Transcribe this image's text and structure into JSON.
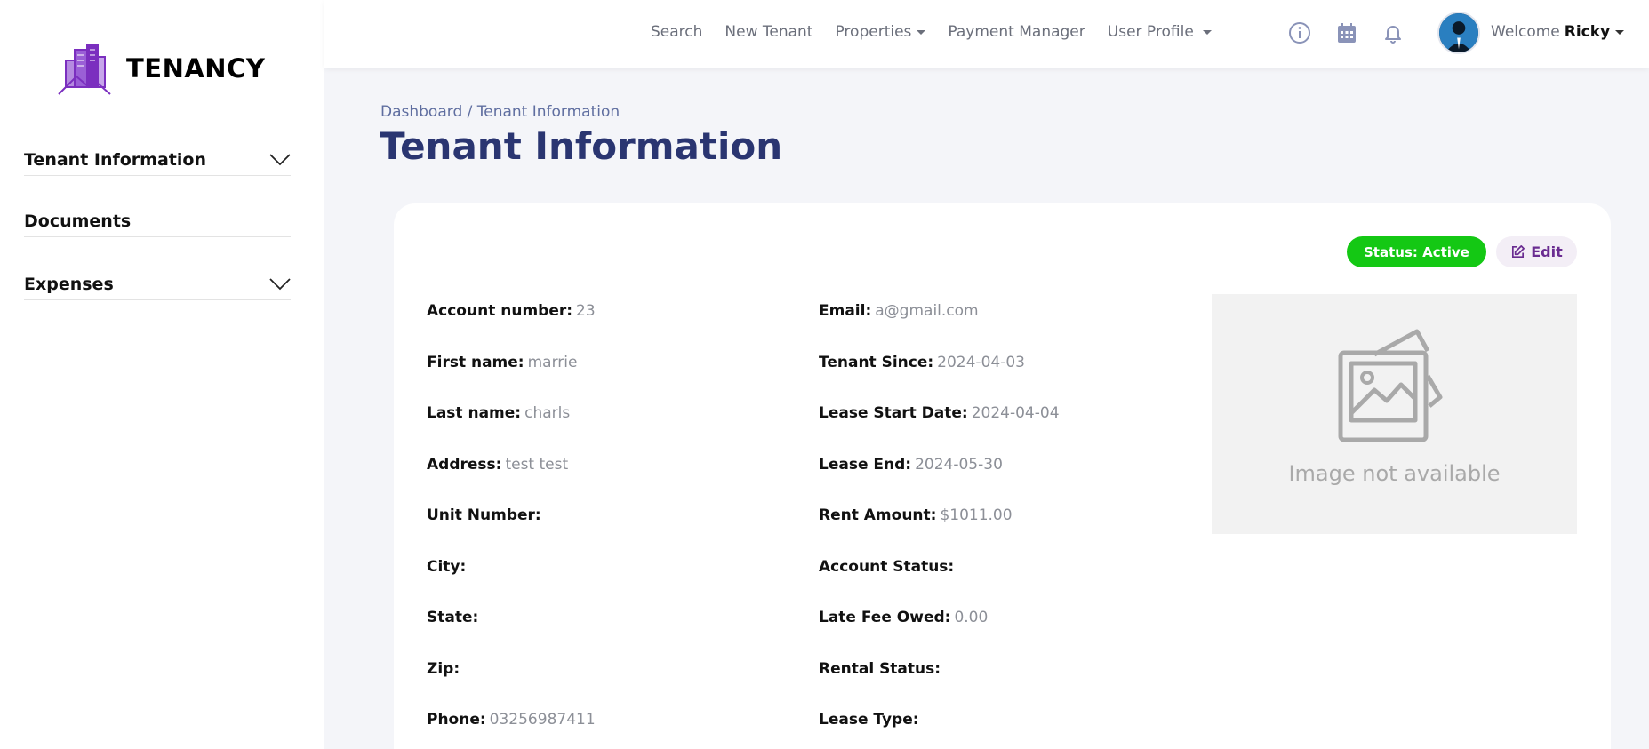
{
  "brand": {
    "name": "TENANCY"
  },
  "sidebar": {
    "items": [
      {
        "label": "Tenant Information",
        "has_chevron": true
      },
      {
        "label": "Documents",
        "has_chevron": false
      },
      {
        "label": "Expenses",
        "has_chevron": true
      }
    ]
  },
  "topnav": {
    "items": [
      {
        "label": "Search"
      },
      {
        "label": "New Tenant"
      },
      {
        "label": "Properties"
      },
      {
        "label": "Payment Manager"
      },
      {
        "label": "User Profile"
      }
    ],
    "icons": [
      "info-icon",
      "calendar-icon",
      "bell-icon"
    ],
    "welcome_prefix": "Welcome",
    "user_name": "Ricky"
  },
  "breadcrumb": "Dashboard / Tenant Information",
  "page_title": "Tenant Information",
  "card": {
    "status_label": "Status: Active",
    "edit_label": "Edit",
    "left_fields": [
      {
        "label": "Account number:",
        "value": "23"
      },
      {
        "label": "First name:",
        "value": "marrie"
      },
      {
        "label": "Last name:",
        "value": "charls"
      },
      {
        "label": "Address:",
        "value": "test test"
      },
      {
        "label": "Unit Number:",
        "value": ""
      },
      {
        "label": "City:",
        "value": ""
      },
      {
        "label": "State:",
        "value": ""
      },
      {
        "label": "Zip:",
        "value": ""
      },
      {
        "label": "Phone:",
        "value": "03256987411"
      }
    ],
    "right_fields": [
      {
        "label": "Email:",
        "value": "a@gmail.com"
      },
      {
        "label": "Tenant Since:",
        "value": "2024-04-03"
      },
      {
        "label": "Lease Start Date:",
        "value": "2024-04-04"
      },
      {
        "label": "Lease End:",
        "value": "2024-05-30"
      },
      {
        "label": "Rent Amount:",
        "value": "$1011.00"
      },
      {
        "label": "Account Status:",
        "value": ""
      },
      {
        "label": "Late Fee Owed:",
        "value": "0.00"
      },
      {
        "label": "Rental Status:",
        "value": ""
      },
      {
        "label": "Lease Type:",
        "value": ""
      }
    ],
    "image_placeholder_text": "Image not available"
  },
  "colors": {
    "accent_title": "#2a3571",
    "status_green": "#14c814",
    "edit_purple": "#6a2c91",
    "logo_purple": "#7b2fbf"
  }
}
